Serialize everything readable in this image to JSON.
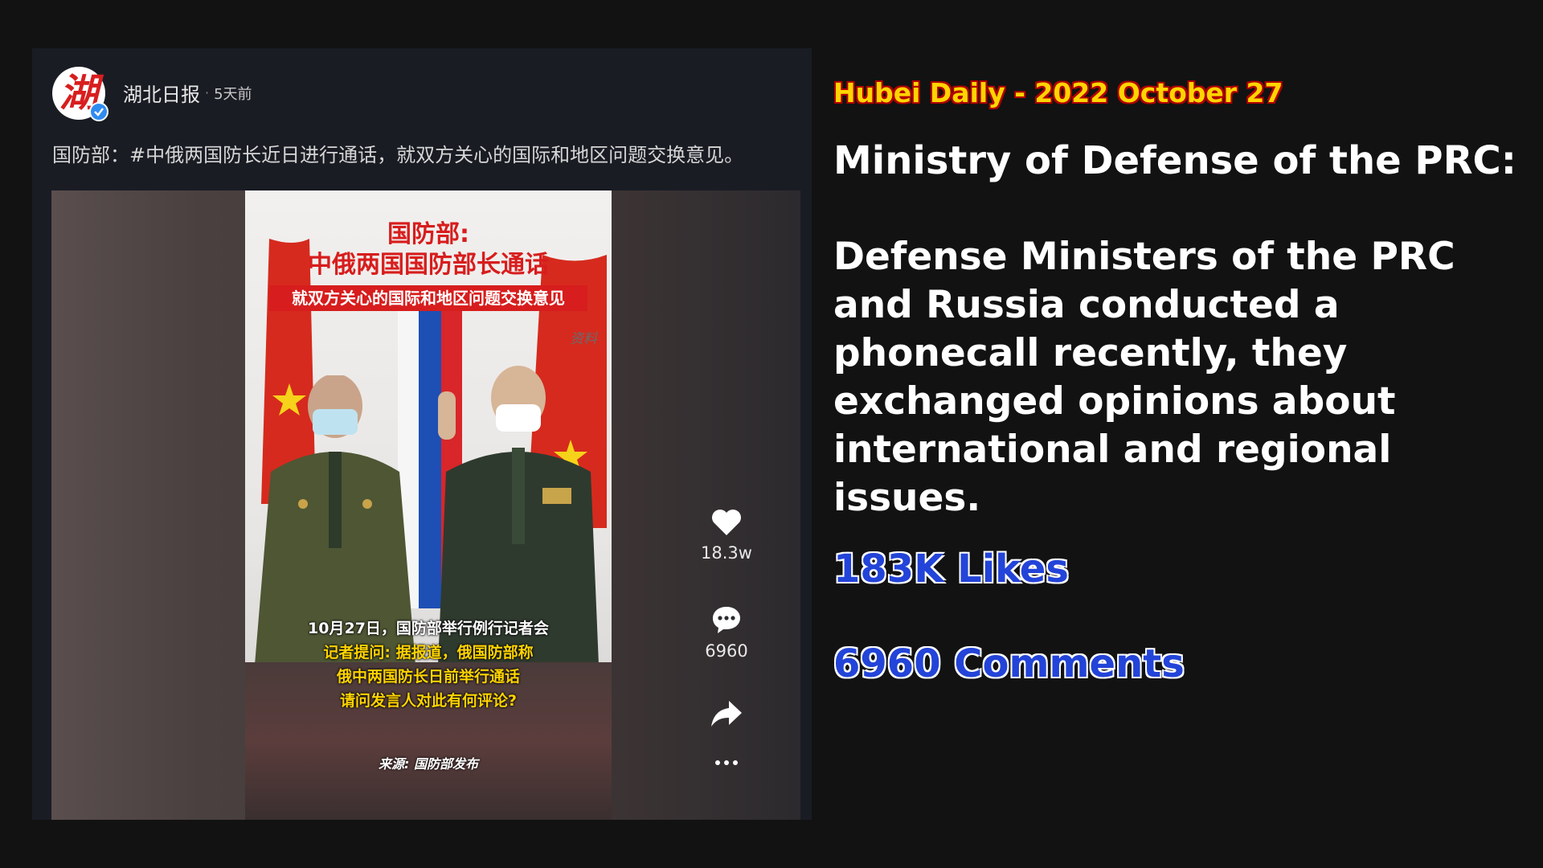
{
  "post": {
    "author": "湖北日报",
    "separator": "·",
    "time_ago": "5天前",
    "avatar_glyph": "湖",
    "caption": "国防部：#中俄两国防长近日进行通话，就双方关心的国际和地区问题交换意见。",
    "video": {
      "title_line1": "国防部:",
      "title_line2": "中俄两国国防部长通话",
      "subtitle": "就双方关心的国际和地区问题交换意见",
      "source_tag": "资料",
      "text_line1": "10月27日，国防部举行例行记者会",
      "text_line2": "记者提问: 据报道，俄国防部称",
      "text_line3": "俄中两国防长日前举行通话",
      "text_line4": "请问发言人对此有何评论?",
      "footer": "来源: 国防部发布"
    },
    "actions": {
      "likes": "18.3w",
      "comments": "6960"
    }
  },
  "annotation": {
    "source_line": "Hubei Daily -  2022 October 27",
    "headline": "Ministry of Defense of the PRC:",
    "body": "Defense Ministers of the PRC and Russia conducted a phonecall recently, they exchanged opinions about international and regional issues.",
    "likes_stat": "183K Likes",
    "comments_stat": "6960 Comments"
  },
  "icons": [
    "verified-badge-icon",
    "heart-icon",
    "comment-icon",
    "share-icon",
    "more-icon"
  ],
  "colors": {
    "background": "#121212",
    "post_panel": "#1a1c24",
    "source_yellow": "#ffd400",
    "source_outline": "#b00000",
    "stat_blue": "#2344d8",
    "verified_blue": "#2f8cf0",
    "frame_red": "#d71d1d"
  }
}
